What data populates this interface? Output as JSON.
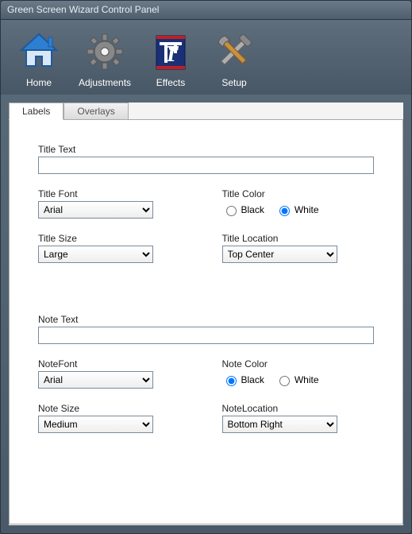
{
  "window": {
    "title": "Green Screen Wizard Control Panel"
  },
  "toolbar": {
    "home": "Home",
    "adjustments": "Adjustments",
    "effects": "Effects",
    "setup": "Setup"
  },
  "tabs": {
    "labels": "Labels",
    "overlays": "Overlays"
  },
  "form": {
    "title_text_label": "Title Text",
    "title_text_value": "",
    "title_font_label": "Title Font",
    "title_font_value": "Arial",
    "title_color_label": "Title Color",
    "title_color_black": "Black",
    "title_color_white": "White",
    "title_color_selected": "White",
    "title_size_label": "Title Size",
    "title_size_value": "Large",
    "title_location_label": "Title Location",
    "title_location_value": "Top Center",
    "note_text_label": "Note Text",
    "note_text_value": "",
    "note_font_label": "NoteFont",
    "note_font_value": "Arial",
    "note_color_label": "Note Color",
    "note_color_black": "Black",
    "note_color_white": "White",
    "note_color_selected": "Black",
    "note_size_label": "Note Size",
    "note_size_value": "Medium",
    "note_location_label": "NoteLocation",
    "note_location_value": "Bottom Right"
  }
}
